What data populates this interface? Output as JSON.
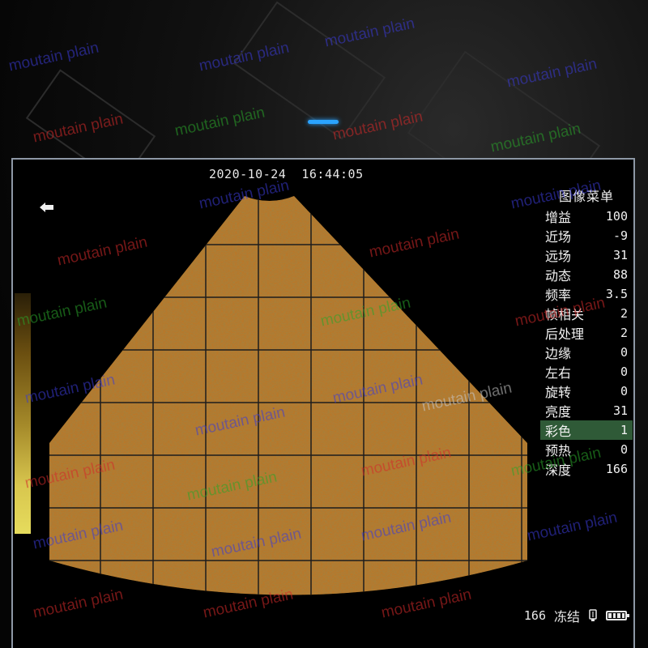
{
  "colors": {
    "accent_blue": "#2aa3ff",
    "scan_orange": "#b9782a",
    "grid_line": "#222222",
    "menu_selected": "#2f5a37",
    "frame_border": "#8e98a6"
  },
  "header": {
    "datetime": "2020-10-24  16:44:05"
  },
  "menu": {
    "title": "图像菜单",
    "items": [
      {
        "label": "增益",
        "value": "100"
      },
      {
        "label": "近场",
        "value": "-9"
      },
      {
        "label": "远场",
        "value": "31"
      },
      {
        "label": "动态",
        "value": "88"
      },
      {
        "label": "频率",
        "value": "3.5"
      },
      {
        "label": "帧相关",
        "value": "2"
      },
      {
        "label": "后处理",
        "value": "2"
      },
      {
        "label": "边缘",
        "value": "0"
      },
      {
        "label": "左右",
        "value": "0"
      },
      {
        "label": "旋转",
        "value": "0"
      },
      {
        "label": "亮度",
        "value": "31"
      },
      {
        "label": "彩色",
        "value": "1"
      },
      {
        "label": "预热",
        "value": "0"
      },
      {
        "label": "深度",
        "value": "166"
      }
    ],
    "selected_index": 11
  },
  "status": {
    "depth": "166",
    "freeze_label": "冻结",
    "battery_level": 1.0
  },
  "icons": {
    "back": "back-arrow-icon",
    "probe": "probe-icon",
    "battery": "battery-icon"
  },
  "watermark": {
    "text": "moutain plain"
  }
}
